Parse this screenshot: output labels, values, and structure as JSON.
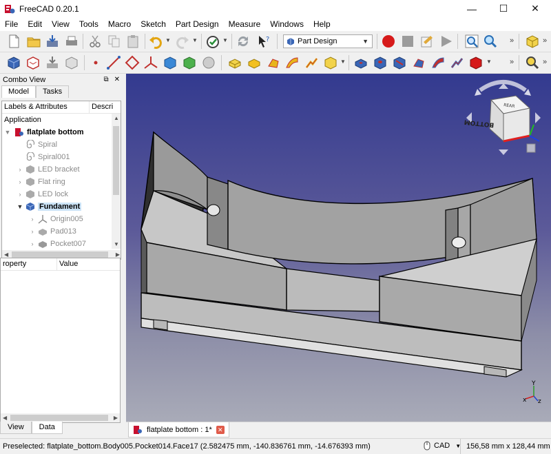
{
  "window": {
    "title": "FreeCAD 0.20.1",
    "minimize": "—",
    "maximize": "☐",
    "close": "✕"
  },
  "menu": [
    "File",
    "Edit",
    "View",
    "Tools",
    "Macro",
    "Sketch",
    "Part Design",
    "Measure",
    "Windows",
    "Help"
  ],
  "toolbar": {
    "workbench": "Part Design",
    "more": "»"
  },
  "combo": {
    "title": "Combo View",
    "float_btn": "⧉",
    "close_btn": "✕",
    "tabs": [
      "Model",
      "Tasks"
    ],
    "tree_headers": [
      "Labels & Attributes",
      "Descri"
    ],
    "tree": [
      {
        "label": "Application",
        "level": 0
      },
      {
        "label": "flatplate bottom",
        "level": 1
      },
      {
        "label": "Spiral",
        "level": 2
      },
      {
        "label": "Spiral001",
        "level": 2
      },
      {
        "label": "LED bracket",
        "level": 2
      },
      {
        "label": "Flat ring",
        "level": 2
      },
      {
        "label": "LED lock",
        "level": 2
      },
      {
        "label": "Fundament",
        "level": 2
      },
      {
        "label": "Origin005",
        "level": 3
      },
      {
        "label": "Pad013",
        "level": 3
      },
      {
        "label": "Pocket007",
        "level": 3
      }
    ],
    "prop_headers": [
      "roperty",
      "Value"
    ],
    "bottom_tabs": [
      "View",
      "Data"
    ]
  },
  "navcube": {
    "top_face": "REAR",
    "front_face": "BOTTOM"
  },
  "axis_labels": {
    "x": "x",
    "y": "Y",
    "z": "z"
  },
  "doc_tab": {
    "label": "flatplate bottom : 1*",
    "close": "✕"
  },
  "status": {
    "message": "Preselected: flatplate_bottom.Body005.Pocket014.Face17 (2.582475 mm, -140.836761 mm, -14.676393 mm)",
    "nav_style": "CAD",
    "dimensions": "156,58 mm x 128,44 mm"
  }
}
